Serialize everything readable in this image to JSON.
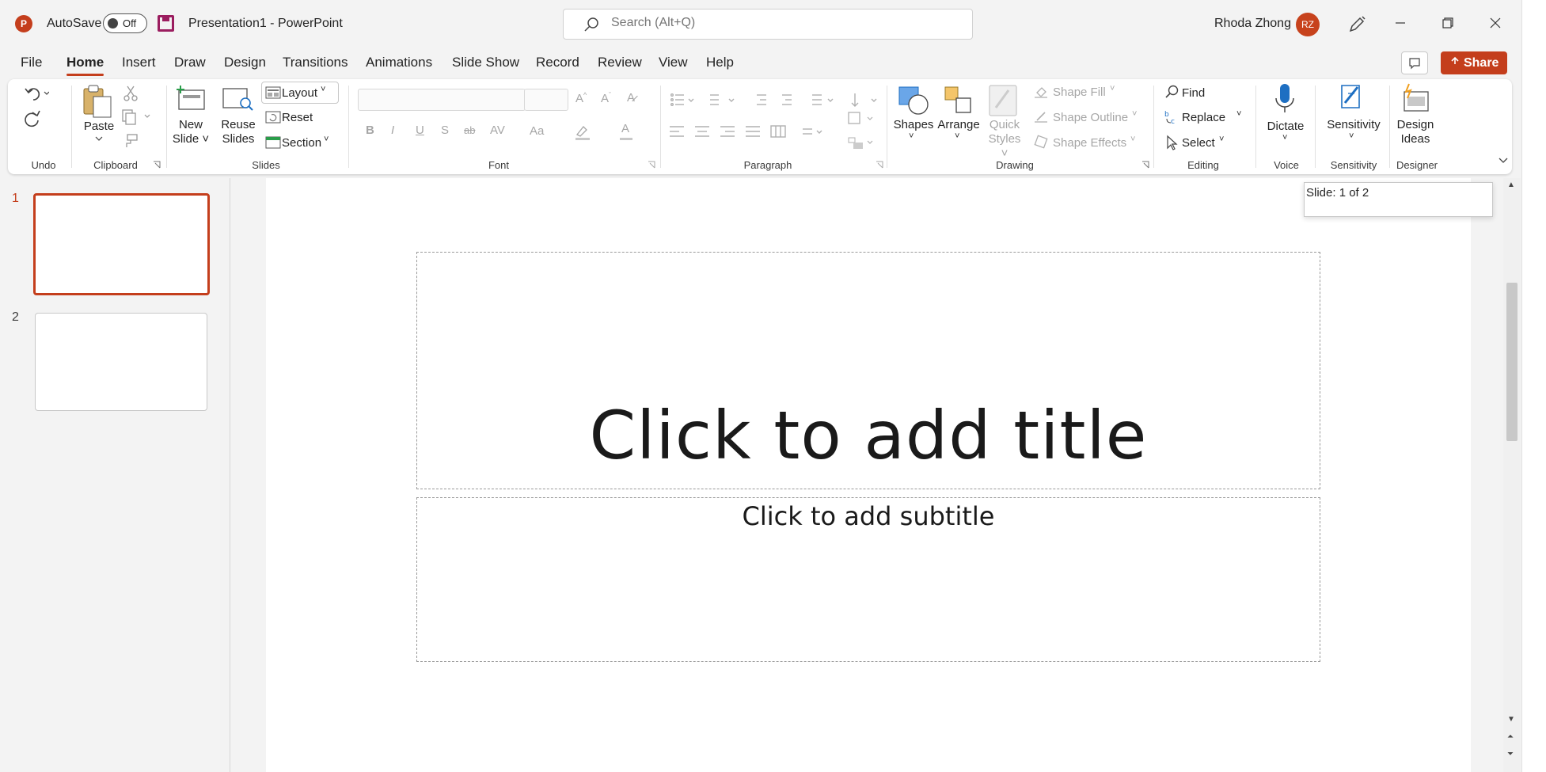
{
  "app": {
    "logo_letter": "P",
    "autosave_label": "AutoSave",
    "autosave_state": "Off",
    "title": "Presentation1  -  PowerPoint",
    "search_placeholder": "Search (Alt+Q)",
    "user_name": "Rhoda Zhong",
    "user_initials": "RZ",
    "brand_color": "#c43e1c"
  },
  "tabs": [
    "File",
    "Home",
    "Insert",
    "Draw",
    "Design",
    "Transitions",
    "Animations",
    "Slide Show",
    "Record",
    "Review",
    "View",
    "Help"
  ],
  "active_tab": "Home",
  "share_label": "Share",
  "ribbon": {
    "groups": [
      "Undo",
      "Clipboard",
      "Slides",
      "Font",
      "Paragraph",
      "Drawing",
      "Editing",
      "Voice",
      "Sensitivity",
      "Designer"
    ],
    "paste": "Paste",
    "new_slide_1": "New",
    "new_slide_2": "Slide",
    "reuse_1": "Reuse",
    "reuse_2": "Slides",
    "layout": "Layout",
    "reset": "Reset",
    "section": "Section",
    "shapes": "Shapes",
    "arrange": "Arrange",
    "quick_styles_1": "Quick",
    "quick_styles_2": "Styles",
    "shape_fill": "Shape Fill",
    "shape_outline": "Shape Outline",
    "shape_effects": "Shape Effects",
    "find": "Find",
    "replace": "Replace",
    "select": "Select",
    "dictate": "Dictate",
    "sensitivity": "Sensitivity",
    "design_ideas_1": "Design",
    "design_ideas_2": "Ideas",
    "font_buttons": [
      "B",
      "I",
      "U",
      "S",
      "ab",
      "AV",
      "Aa",
      "A"
    ]
  },
  "slides": [
    {
      "number": "1",
      "selected": true
    },
    {
      "number": "2",
      "selected": false
    }
  ],
  "slide": {
    "title_placeholder": "Click to add title",
    "subtitle_placeholder": "Click to add subtitle"
  },
  "status_tooltip": "Slide: 1 of 2"
}
